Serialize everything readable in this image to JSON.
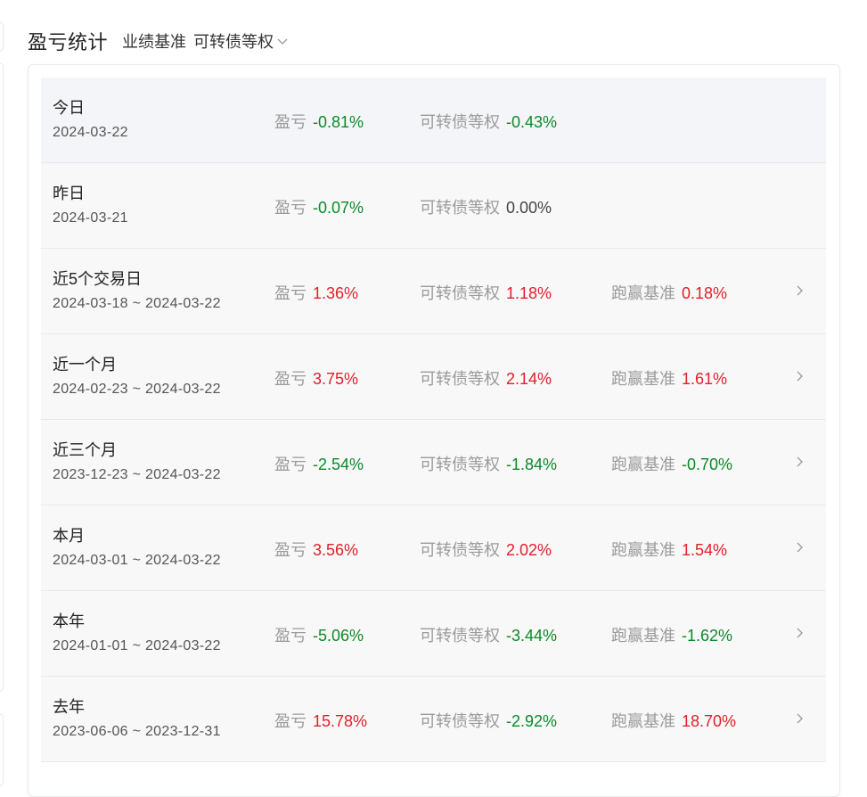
{
  "header": {
    "title": "盈亏统计",
    "benchmark_label": "业绩基准",
    "benchmark_value": "可转债等权"
  },
  "colors": {
    "up": "#e0202a",
    "down": "#0b8a28",
    "flat": "#444444",
    "label": "#9a9a9a"
  },
  "labels": {
    "pnl": "盈亏",
    "benchmark": "可转债等权",
    "excess": "跑赢基准"
  },
  "rows": [
    {
      "name": "今日",
      "date": "2024-03-22",
      "pnl": "-0.81%",
      "bench": "-0.43%",
      "excess": null
    },
    {
      "name": "昨日",
      "date": "2024-03-21",
      "pnl": "-0.07%",
      "bench": "0.00%",
      "excess": null
    },
    {
      "name": "近5个交易日",
      "date": "2024-03-18 ~ 2024-03-22",
      "pnl": "1.36%",
      "bench": "1.18%",
      "excess": "0.18%"
    },
    {
      "name": "近一个月",
      "date": "2024-02-23 ~ 2024-03-22",
      "pnl": "3.75%",
      "bench": "2.14%",
      "excess": "1.61%"
    },
    {
      "name": "近三个月",
      "date": "2023-12-23 ~ 2024-03-22",
      "pnl": "-2.54%",
      "bench": "-1.84%",
      "excess": "-0.70%"
    },
    {
      "name": "本月",
      "date": "2024-03-01 ~ 2024-03-22",
      "pnl": "3.56%",
      "bench": "2.02%",
      "excess": "1.54%"
    },
    {
      "name": "本年",
      "date": "2024-01-01 ~ 2024-03-22",
      "pnl": "-5.06%",
      "bench": "-3.44%",
      "excess": "-1.62%"
    },
    {
      "name": "去年",
      "date": "2023-06-06 ~ 2023-12-31",
      "pnl": "15.78%",
      "bench": "-2.92%",
      "excess": "18.70%"
    }
  ]
}
